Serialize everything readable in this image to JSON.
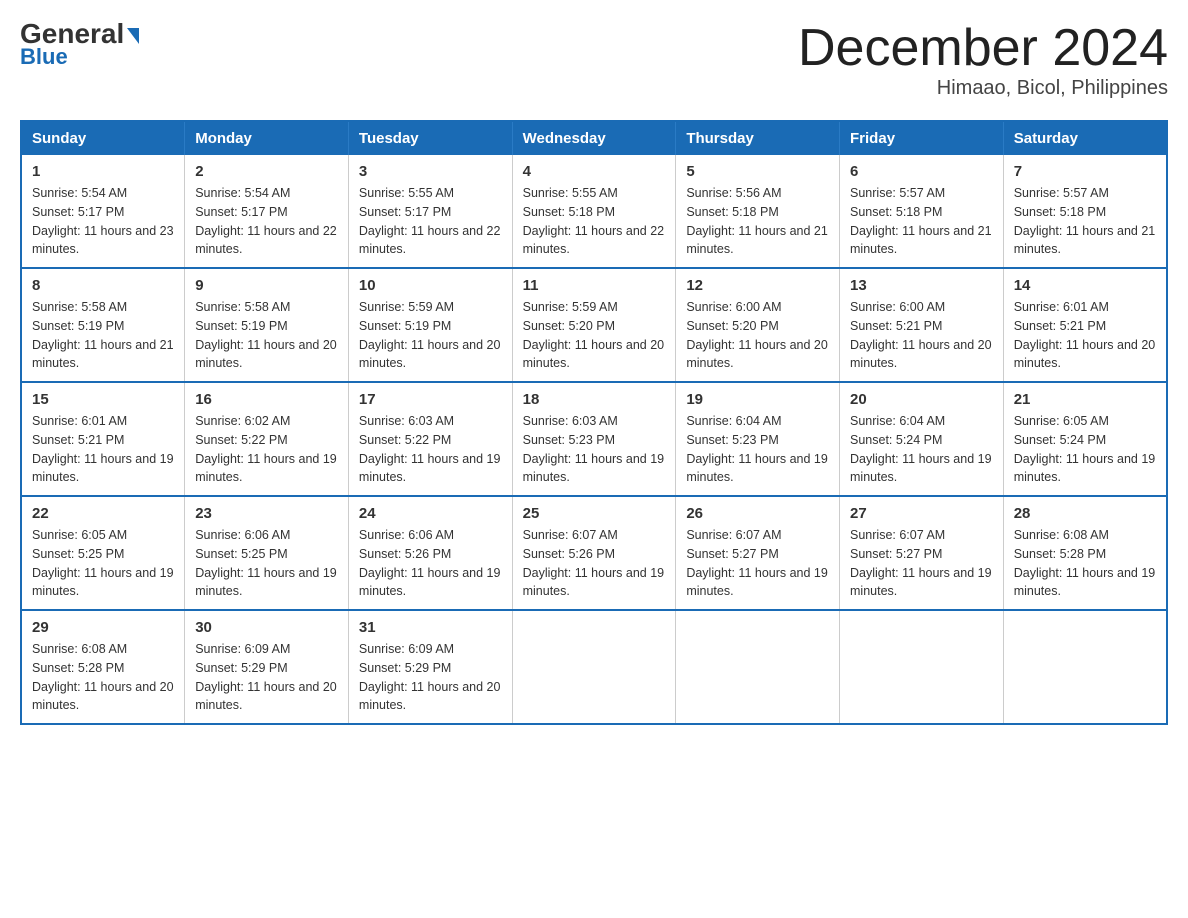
{
  "header": {
    "logo_main": "General",
    "logo_sub": "Blue",
    "month_title": "December 2024",
    "subtitle": "Himaao, Bicol, Philippines"
  },
  "days_of_week": [
    "Sunday",
    "Monday",
    "Tuesday",
    "Wednesday",
    "Thursday",
    "Friday",
    "Saturday"
  ],
  "weeks": [
    [
      {
        "day": "1",
        "sunrise": "5:54 AM",
        "sunset": "5:17 PM",
        "daylight": "11 hours and 23 minutes."
      },
      {
        "day": "2",
        "sunrise": "5:54 AM",
        "sunset": "5:17 PM",
        "daylight": "11 hours and 22 minutes."
      },
      {
        "day": "3",
        "sunrise": "5:55 AM",
        "sunset": "5:17 PM",
        "daylight": "11 hours and 22 minutes."
      },
      {
        "day": "4",
        "sunrise": "5:55 AM",
        "sunset": "5:18 PM",
        "daylight": "11 hours and 22 minutes."
      },
      {
        "day": "5",
        "sunrise": "5:56 AM",
        "sunset": "5:18 PM",
        "daylight": "11 hours and 21 minutes."
      },
      {
        "day": "6",
        "sunrise": "5:57 AM",
        "sunset": "5:18 PM",
        "daylight": "11 hours and 21 minutes."
      },
      {
        "day": "7",
        "sunrise": "5:57 AM",
        "sunset": "5:18 PM",
        "daylight": "11 hours and 21 minutes."
      }
    ],
    [
      {
        "day": "8",
        "sunrise": "5:58 AM",
        "sunset": "5:19 PM",
        "daylight": "11 hours and 21 minutes."
      },
      {
        "day": "9",
        "sunrise": "5:58 AM",
        "sunset": "5:19 PM",
        "daylight": "11 hours and 20 minutes."
      },
      {
        "day": "10",
        "sunrise": "5:59 AM",
        "sunset": "5:19 PM",
        "daylight": "11 hours and 20 minutes."
      },
      {
        "day": "11",
        "sunrise": "5:59 AM",
        "sunset": "5:20 PM",
        "daylight": "11 hours and 20 minutes."
      },
      {
        "day": "12",
        "sunrise": "6:00 AM",
        "sunset": "5:20 PM",
        "daylight": "11 hours and 20 minutes."
      },
      {
        "day": "13",
        "sunrise": "6:00 AM",
        "sunset": "5:21 PM",
        "daylight": "11 hours and 20 minutes."
      },
      {
        "day": "14",
        "sunrise": "6:01 AM",
        "sunset": "5:21 PM",
        "daylight": "11 hours and 20 minutes."
      }
    ],
    [
      {
        "day": "15",
        "sunrise": "6:01 AM",
        "sunset": "5:21 PM",
        "daylight": "11 hours and 19 minutes."
      },
      {
        "day": "16",
        "sunrise": "6:02 AM",
        "sunset": "5:22 PM",
        "daylight": "11 hours and 19 minutes."
      },
      {
        "day": "17",
        "sunrise": "6:03 AM",
        "sunset": "5:22 PM",
        "daylight": "11 hours and 19 minutes."
      },
      {
        "day": "18",
        "sunrise": "6:03 AM",
        "sunset": "5:23 PM",
        "daylight": "11 hours and 19 minutes."
      },
      {
        "day": "19",
        "sunrise": "6:04 AM",
        "sunset": "5:23 PM",
        "daylight": "11 hours and 19 minutes."
      },
      {
        "day": "20",
        "sunrise": "6:04 AM",
        "sunset": "5:24 PM",
        "daylight": "11 hours and 19 minutes."
      },
      {
        "day": "21",
        "sunrise": "6:05 AM",
        "sunset": "5:24 PM",
        "daylight": "11 hours and 19 minutes."
      }
    ],
    [
      {
        "day": "22",
        "sunrise": "6:05 AM",
        "sunset": "5:25 PM",
        "daylight": "11 hours and 19 minutes."
      },
      {
        "day": "23",
        "sunrise": "6:06 AM",
        "sunset": "5:25 PM",
        "daylight": "11 hours and 19 minutes."
      },
      {
        "day": "24",
        "sunrise": "6:06 AM",
        "sunset": "5:26 PM",
        "daylight": "11 hours and 19 minutes."
      },
      {
        "day": "25",
        "sunrise": "6:07 AM",
        "sunset": "5:26 PM",
        "daylight": "11 hours and 19 minutes."
      },
      {
        "day": "26",
        "sunrise": "6:07 AM",
        "sunset": "5:27 PM",
        "daylight": "11 hours and 19 minutes."
      },
      {
        "day": "27",
        "sunrise": "6:07 AM",
        "sunset": "5:27 PM",
        "daylight": "11 hours and 19 minutes."
      },
      {
        "day": "28",
        "sunrise": "6:08 AM",
        "sunset": "5:28 PM",
        "daylight": "11 hours and 19 minutes."
      }
    ],
    [
      {
        "day": "29",
        "sunrise": "6:08 AM",
        "sunset": "5:28 PM",
        "daylight": "11 hours and 20 minutes."
      },
      {
        "day": "30",
        "sunrise": "6:09 AM",
        "sunset": "5:29 PM",
        "daylight": "11 hours and 20 minutes."
      },
      {
        "day": "31",
        "sunrise": "6:09 AM",
        "sunset": "5:29 PM",
        "daylight": "11 hours and 20 minutes."
      },
      null,
      null,
      null,
      null
    ]
  ]
}
